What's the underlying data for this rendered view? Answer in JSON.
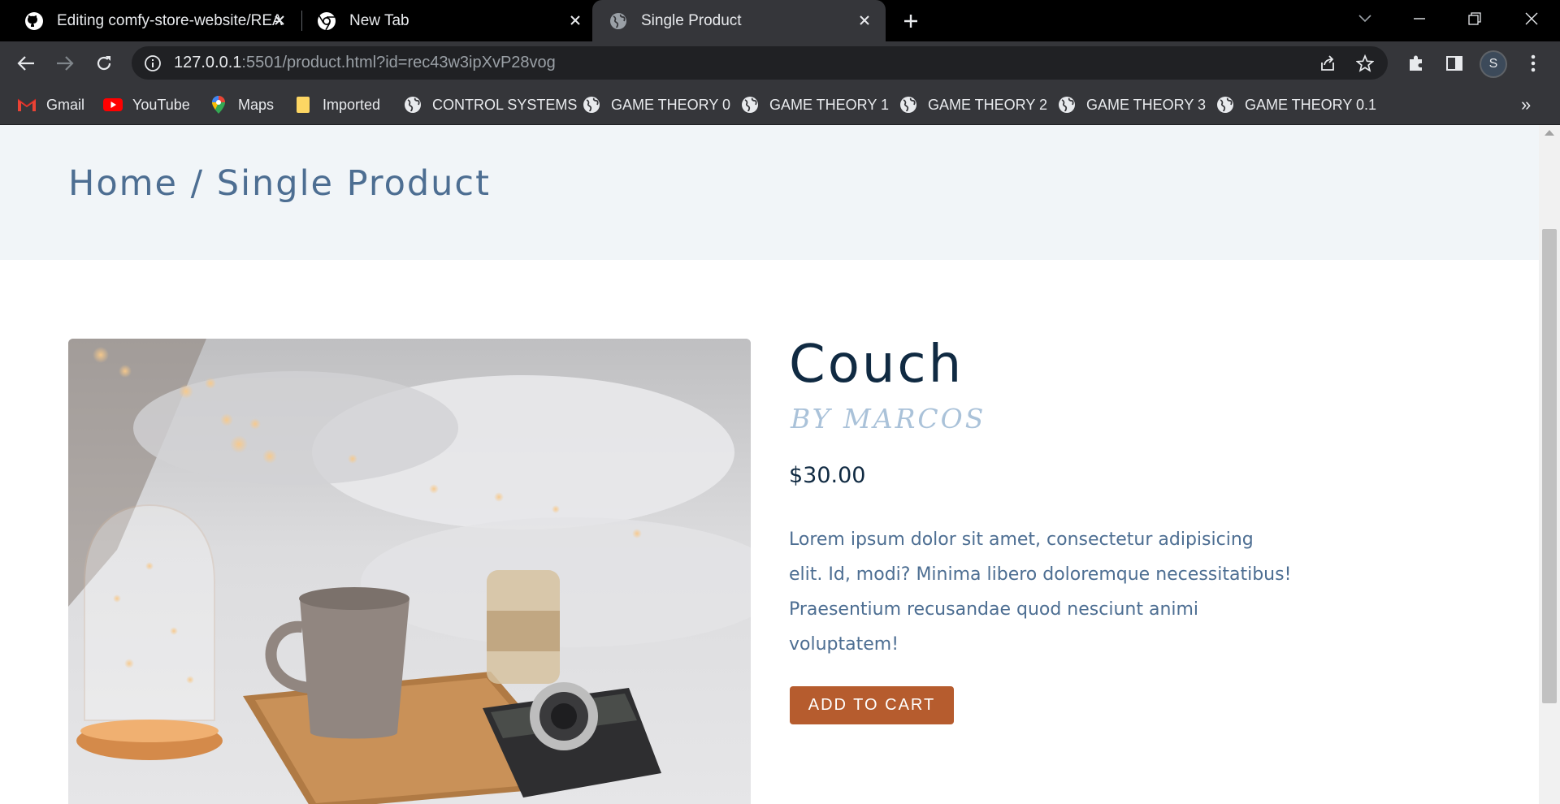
{
  "browser": {
    "tabs": [
      {
        "title": "Editing comfy-store-website/REA",
        "icon": "github-icon",
        "active": false
      },
      {
        "title": "New Tab",
        "icon": "chrome-icon",
        "active": false
      },
      {
        "title": "Single Product",
        "icon": "globe-icon",
        "active": true
      }
    ],
    "url": {
      "host": "127.0.0.1",
      "rest": ":5501/product.html?id=rec43w3ipXvP28vog"
    },
    "profile_initial": "S",
    "bookmarks": [
      {
        "label": "Gmail",
        "icon": "gmail-icon"
      },
      {
        "label": "YouTube",
        "icon": "youtube-icon"
      },
      {
        "label": "Maps",
        "icon": "maps-pin-icon"
      },
      {
        "label": "Imported",
        "icon": "folder-icon"
      },
      {
        "label": "CONTROL SYSTEMS",
        "icon": "globe-icon"
      },
      {
        "label": "GAME THEORY 0",
        "icon": "globe-icon"
      },
      {
        "label": "GAME THEORY 1",
        "icon": "globe-icon"
      },
      {
        "label": "GAME THEORY 2",
        "icon": "globe-icon"
      },
      {
        "label": "GAME THEORY 3",
        "icon": "globe-icon"
      },
      {
        "label": "GAME THEORY 0.1",
        "icon": "globe-icon"
      }
    ],
    "bookmarks_overflow": "»"
  },
  "page": {
    "breadcrumb": "Home / Single Product",
    "product": {
      "title": "Couch",
      "company": "BY MARCOS",
      "price": "$30.00",
      "description": "Lorem ipsum dolor sit amet, consectetur adipisicing elit. Id, modi? Minima libero doloremque necessitatibus! Praesentium recusandae quod nesciunt animi voluptatem!",
      "add_to_cart_label": "ADD TO CART"
    }
  },
  "colors": {
    "primary_dark": "#102a42",
    "text_muted": "#4d6e92",
    "company": "#aac2d9",
    "hero_bg": "#f1f5f8",
    "button": "#b65c2e"
  }
}
